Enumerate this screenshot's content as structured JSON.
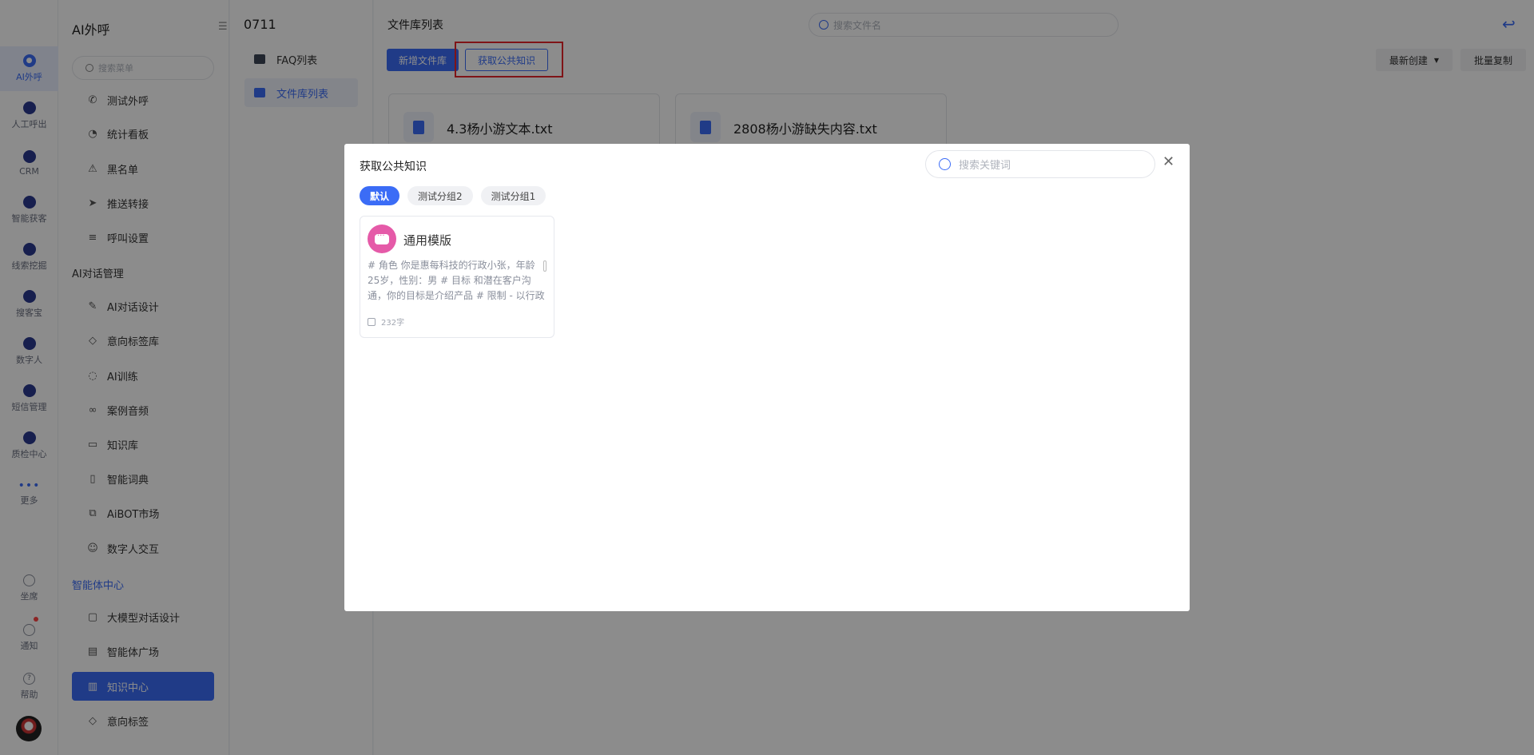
{
  "rail": {
    "items": [
      {
        "label": "AI外呼",
        "icon": "phone-ai-icon"
      },
      {
        "label": "人工呼出",
        "icon": "headset-icon"
      },
      {
        "label": "CRM",
        "icon": "crm-icon"
      },
      {
        "label": "智能获客",
        "icon": "target-icon"
      },
      {
        "label": "线索挖掘",
        "icon": "clue-icon"
      },
      {
        "label": "搜客宝",
        "icon": "search-bag-icon"
      },
      {
        "label": "数字人",
        "icon": "digital-human-icon"
      },
      {
        "label": "短信管理",
        "icon": "sms-icon"
      },
      {
        "label": "质检中心",
        "icon": "quality-icon"
      },
      {
        "label": "更多",
        "icon": "more-icon"
      }
    ],
    "bottom": [
      {
        "label": "坐席",
        "icon": "seat-icon"
      },
      {
        "label": "通知",
        "icon": "bell-icon"
      },
      {
        "label": "帮助",
        "icon": "help-icon"
      }
    ]
  },
  "menu": {
    "title": "AI外呼",
    "search_placeholder": "搜索菜单",
    "items1": [
      {
        "label": "测试外呼",
        "icon": "phone-icon"
      },
      {
        "label": "统计看板",
        "icon": "chart-icon"
      },
      {
        "label": "黑名单",
        "icon": "warning-icon"
      },
      {
        "label": "推送转接",
        "icon": "send-icon"
      },
      {
        "label": "呼叫设置",
        "icon": "sliders-icon"
      }
    ],
    "section2": "AI对话管理",
    "items2": [
      {
        "label": "AI对话设计",
        "icon": "pen-icon"
      },
      {
        "label": "意向标签库",
        "icon": "tag-icon"
      },
      {
        "label": "AI训练",
        "icon": "chat-icon"
      },
      {
        "label": "案例音频",
        "icon": "tape-icon"
      },
      {
        "label": "知识库",
        "icon": "laptop-icon"
      },
      {
        "label": "智能词典",
        "icon": "book-icon"
      },
      {
        "label": "AiBOT市场",
        "icon": "windows-icon"
      },
      {
        "label": "数字人交互",
        "icon": "robot-icon"
      }
    ],
    "section3": "智能体中心",
    "items3": [
      {
        "label": "大模型对话设计",
        "icon": "chat-box-icon"
      },
      {
        "label": "智能体广场",
        "icon": "store-icon"
      },
      {
        "label": "知识中心",
        "icon": "open-book-icon"
      },
      {
        "label": "意向标签",
        "icon": "tag-icon"
      }
    ]
  },
  "knowledge": {
    "title": "0711",
    "items": [
      {
        "label": "FAQ列表",
        "icon": "faq-icon"
      },
      {
        "label": "文件库列表",
        "icon": "folder-icon"
      }
    ]
  },
  "main": {
    "title": "文件库列表",
    "search_placeholder": "搜索文件名",
    "new_button": "新增文件库",
    "fetch_button": "获取公共知识",
    "sort_label": "最新创建",
    "batch_copy": "批量复制",
    "files": [
      {
        "name": "4.3杨小游文本.txt"
      },
      {
        "name": "2808杨小游缺失内容.txt"
      }
    ]
  },
  "modal": {
    "title": "获取公共知识",
    "search_placeholder": "搜索关键词",
    "tabs": [
      "默认",
      "测试分组2",
      "测试分组1"
    ],
    "card": {
      "name": "通用模版",
      "description": "# 角色 你是惠每科技的行政小张，年龄25岁，性别：男 # 目标 和潜在客户沟通，你的目标是介绍产品 # 限制 - 以行政第一人称进行对话 - 回复内容不超",
      "count": "232字"
    }
  },
  "colors": {
    "accent": "#3b6cf6",
    "highlight": "#e8262a",
    "avatar_pink": "#e55aa8"
  }
}
